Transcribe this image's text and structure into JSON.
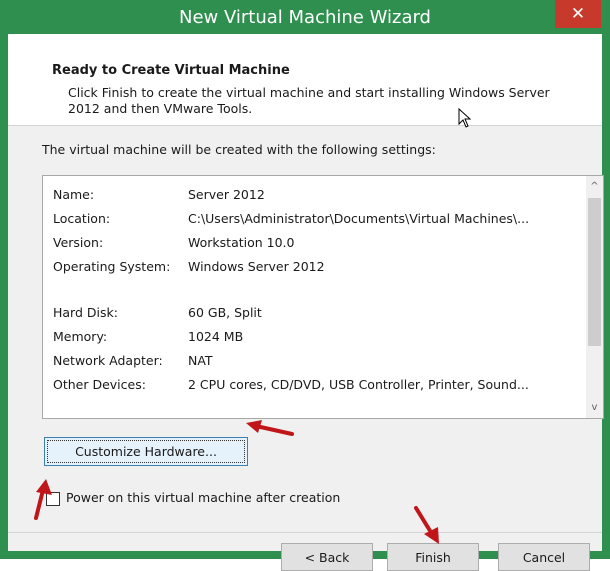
{
  "window": {
    "title": "New Virtual Machine Wizard",
    "close_icon": "close-icon"
  },
  "header": {
    "title": "Ready to Create Virtual Machine",
    "description": "Click Finish to create the virtual machine and start installing Windows Server 2012 and then VMware Tools."
  },
  "intro": "The virtual machine will be created with the following settings:",
  "settings": {
    "name_label": "Name:",
    "name_value": "Server 2012",
    "location_label": "Location:",
    "location_value": "C:\\Users\\Administrator\\Documents\\Virtual Machines\\...",
    "version_label": "Version:",
    "version_value": "Workstation 10.0",
    "os_label": "Operating System:",
    "os_value": "Windows Server 2012",
    "disk_label": "Hard Disk:",
    "disk_value": "60 GB, Split",
    "memory_label": "Memory:",
    "memory_value": "1024 MB",
    "network_label": "Network Adapter:",
    "network_value": "NAT",
    "devices_label": "Other Devices:",
    "devices_value": "2 CPU cores, CD/DVD, USB Controller, Printer, Sound..."
  },
  "customize_label": "Customize Hardware...",
  "power_on": {
    "label": "Power on this virtual machine after creation",
    "checked": false
  },
  "buttons": {
    "back": "< Back",
    "finish": "Finish",
    "cancel": "Cancel"
  },
  "colors": {
    "title_bar": "#2f8f4f",
    "close": "#c7392b",
    "annotation_arrow": "#c0161a"
  }
}
